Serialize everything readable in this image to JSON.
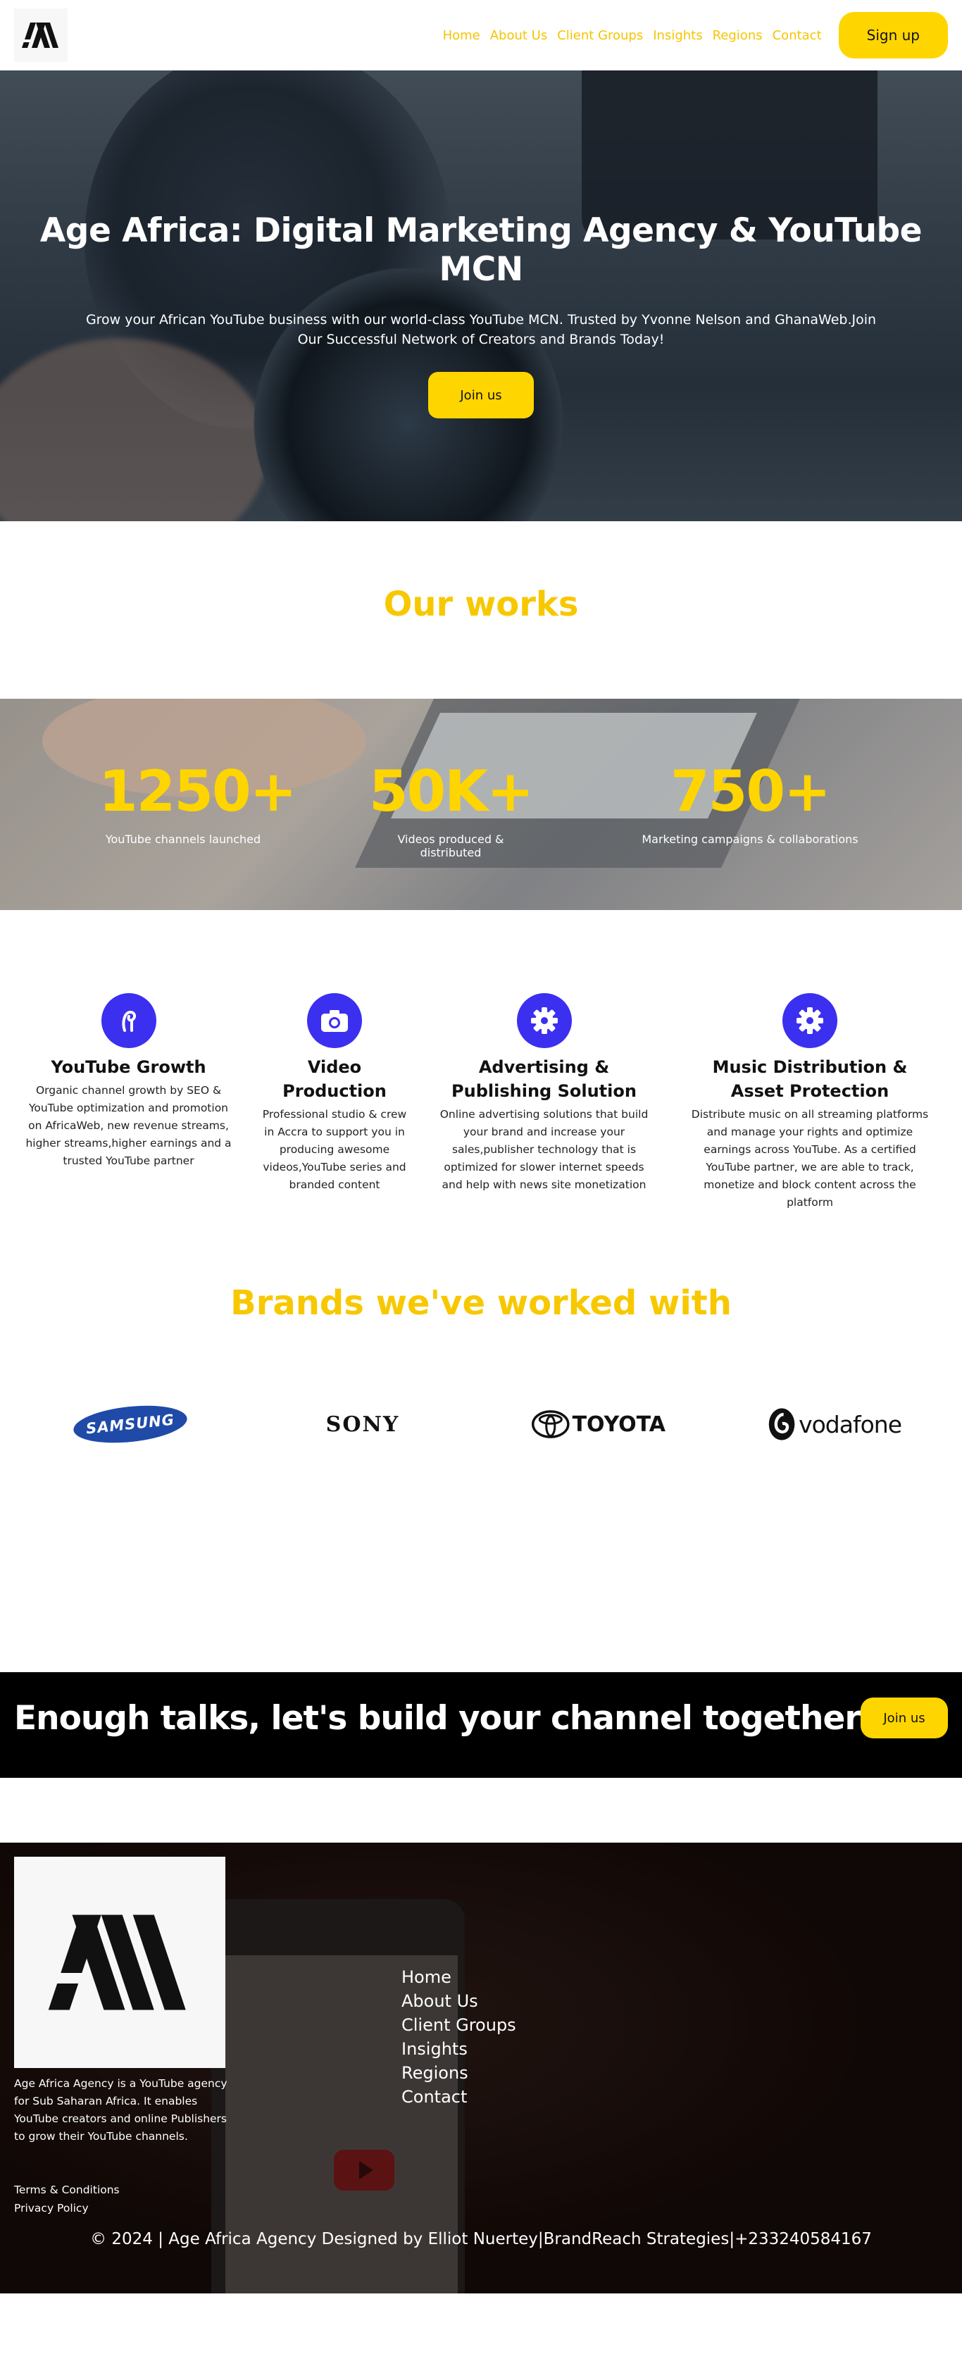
{
  "header": {
    "nav": [
      "Home",
      "About Us",
      "Client Groups",
      "Insights",
      "Regions",
      "Contact"
    ],
    "signup_label": "Sign up"
  },
  "hero": {
    "title": "Age Africa: Digital Marketing Agency & YouTube MCN",
    "subtitle": "Grow your African YouTube business with our world-class YouTube MCN. Trusted by Yvonne Nelson and GhanaWeb.Join Our Successful Network of Creators and Brands Today!",
    "button_label": "Join us"
  },
  "works": {
    "title": "Our works",
    "stats": [
      {
        "value": "1250+",
        "label": "YouTube channels launched"
      },
      {
        "value": "50K+",
        "label": "Videos produced & distributed"
      },
      {
        "value": "750+",
        "label": "Marketing campaigns & collaborations"
      }
    ]
  },
  "services": [
    {
      "icon": "growth-icon",
      "title": "YouTube Growth",
      "text": "Organic channel growth by SEO & YouTube optimization and promotion on AfricaWeb, new revenue streams, higher streams,higher earnings and a trusted YouTube partner"
    },
    {
      "icon": "camera-icon",
      "title": "Video Production",
      "text": "Professional studio & crew in Accra to support you in producing awesome videos,YouTube series and branded content"
    },
    {
      "icon": "gear-icon",
      "title": "Advertising & Publishing Solution",
      "text": "Online advertising solutions that build your brand and increase your sales,publisher technology that is optimized for slower internet speeds and help with news site monetization"
    },
    {
      "icon": "gear-icon",
      "title": "Music Distribution & Asset Protection",
      "text": "Distribute music on all streaming platforms and manage your rights and optimize earnings across YouTube. As a certified YouTube partner, we are able to track, monetize and block content across the platform"
    }
  ],
  "brands": {
    "title": "Brands we've worked with",
    "items": [
      "SAMSUNG",
      "SONY",
      "TOYOTA",
      "vodafone"
    ]
  },
  "cta": {
    "text": "Enough talks, let's build your channel together",
    "button_label": "Join us"
  },
  "footer": {
    "about": "Age Africa Agency is a YouTube agency for Sub Saharan Africa. It enables YouTube creators and online Publishers to grow their YouTube channels.",
    "links": [
      "Terms & Conditions",
      "Privacy Policy"
    ],
    "nav": [
      "Home",
      "About Us",
      "Client Groups",
      "Insights",
      "Regions",
      "Contact"
    ],
    "copyright": "© 2024 | Age Africa Agency Designed by Elliot Nuertey|BrandReach Strategies|+233240584167"
  },
  "colors": {
    "accent_yellow": "#ffd500",
    "icon_blue": "#3b2ff0",
    "cta_bg": "#000000"
  }
}
